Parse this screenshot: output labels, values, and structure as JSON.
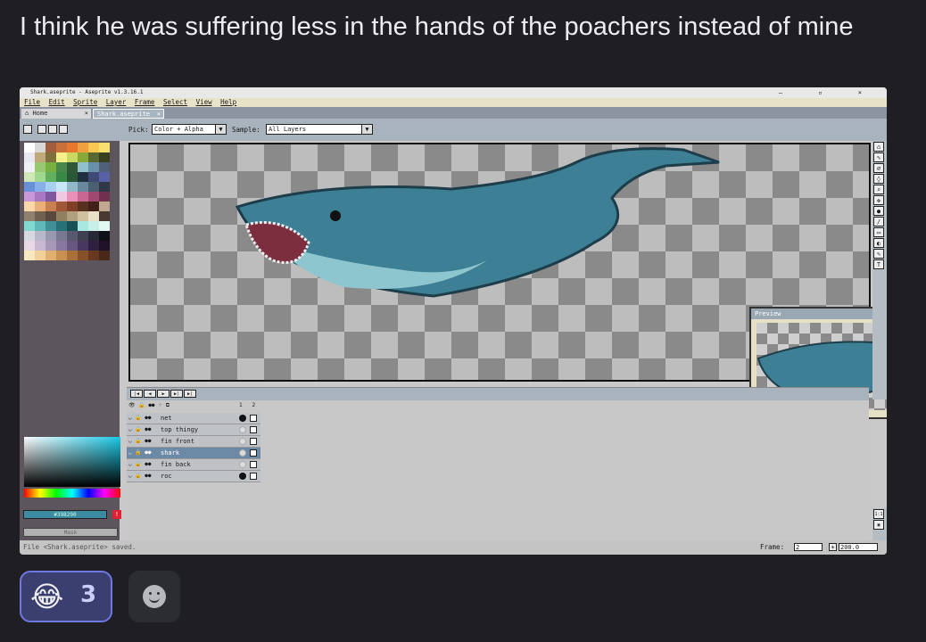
{
  "message": {
    "text": "I think he was suffering less in the hands of the poachers instead of mine"
  },
  "app": {
    "window_title": "Shark.aseprite - Aseprite v1.3.16.1",
    "window_controls": "– ▫ ×",
    "menu": [
      "File",
      "Edit",
      "Sprite",
      "Layer",
      "Frame",
      "Select",
      "View",
      "Help"
    ],
    "tabs": [
      {
        "label": "Home",
        "close": "×"
      },
      {
        "label": "Shark.aseprite",
        "close": "×"
      }
    ],
    "toolbar": {
      "pick_label": "Pick:",
      "pick_value": "Color + Alpha",
      "sample_label": "Sample:",
      "sample_value": "All Layers",
      "dropdown_arrow": "▼"
    },
    "palette_colors": [
      "#ffffff",
      "#d8d8d8",
      "#a06040",
      "#c87038",
      "#e87830",
      "#f0a040",
      "#f8c850",
      "#f8e070",
      "#e8e8f0",
      "#c0a878",
      "#807040",
      "#f8f088",
      "#c8d860",
      "#88a838",
      "#586830",
      "#384020",
      "#f0f0f8",
      "#98c870",
      "#78b040",
      "#48884c",
      "#305838",
      "#90c0c8",
      "#6890a8",
      "#506078",
      "#d0e8b8",
      "#a0d890",
      "#60b060",
      "#388848",
      "#285838",
      "#203040",
      "#404878",
      "#5860a8",
      "#6890d8",
      "#88b0e8",
      "#a8d0f0",
      "#c8e8f8",
      "#90b8c8",
      "#6888a0",
      "#486070",
      "#303848",
      "#c898d8",
      "#a878c0",
      "#8058a0",
      "#f0c8e0",
      "#e890b8",
      "#c86890",
      "#a04870",
      "#703050",
      "#f8d8a8",
      "#e8b078",
      "#c88050",
      "#a05838",
      "#804028",
      "#583020",
      "#402018",
      "#c0a890",
      "#908070",
      "#706050",
      "#584840",
      "#908060",
      "#b0a080",
      "#d0c0a0",
      "#e8e0c8",
      "#483830",
      "#80d8d0",
      "#60b8b8",
      "#409098",
      "#287078",
      "#185058",
      "#a8e8e0",
      "#c8f0e8",
      "#e0f8f0",
      "#d8d8e0",
      "#b8b8c8",
      "#9898b0",
      "#787890",
      "#585870",
      "#404050",
      "#282838",
      "#101018",
      "#e8d8e8",
      "#c8b8d0",
      "#a898b8",
      "#8878a0",
      "#685880",
      "#483860",
      "#302040",
      "#201028",
      "#f8e8c0",
      "#f0d098",
      "#e0b070",
      "#c89050",
      "#a87038",
      "#885028",
      "#683820",
      "#482818"
    ],
    "color": {
      "hex": "#398290",
      "warn": "!",
      "mask_label": "Mask"
    },
    "preview": {
      "title": "Preview",
      "controls": "▣▶✕"
    },
    "right_tools": [
      "⌂",
      "✎",
      "⌀",
      "◊",
      "⌕",
      "✥",
      "●",
      "/",
      "▭",
      "◐",
      "✎",
      "T"
    ],
    "bottom_tools": [
      "1:1",
      "▣"
    ],
    "timeline": {
      "buttons": [
        "|◀",
        "◀",
        "▶",
        "▶|",
        "▶|"
      ],
      "header_icons": "👁 🔒 ●● ⁘ ⧉",
      "frame_numbers": [
        "1",
        "2"
      ],
      "layers": [
        {
          "name": "net",
          "active": false,
          "cel1": "filled"
        },
        {
          "name": "top thingy",
          "active": false,
          "cel1": "empty"
        },
        {
          "name": "fin front",
          "active": false,
          "cel1": "empty"
        },
        {
          "name": "shark",
          "active": true,
          "cel1": "empty"
        },
        {
          "name": "fin back",
          "active": false,
          "cel1": "empty"
        },
        {
          "name": "roc",
          "active": false,
          "cel1": "filled"
        }
      ],
      "layer_row_icons": "◡ 🔒 ●●"
    },
    "status": {
      "message": "File <Shark.aseprite> saved.",
      "frame_label": "Frame:",
      "frame_value": "2",
      "plus": "+",
      "zoom": "200.0"
    }
  },
  "reactions": [
    {
      "emoji": "😂",
      "count": "3",
      "selected": true
    }
  ]
}
